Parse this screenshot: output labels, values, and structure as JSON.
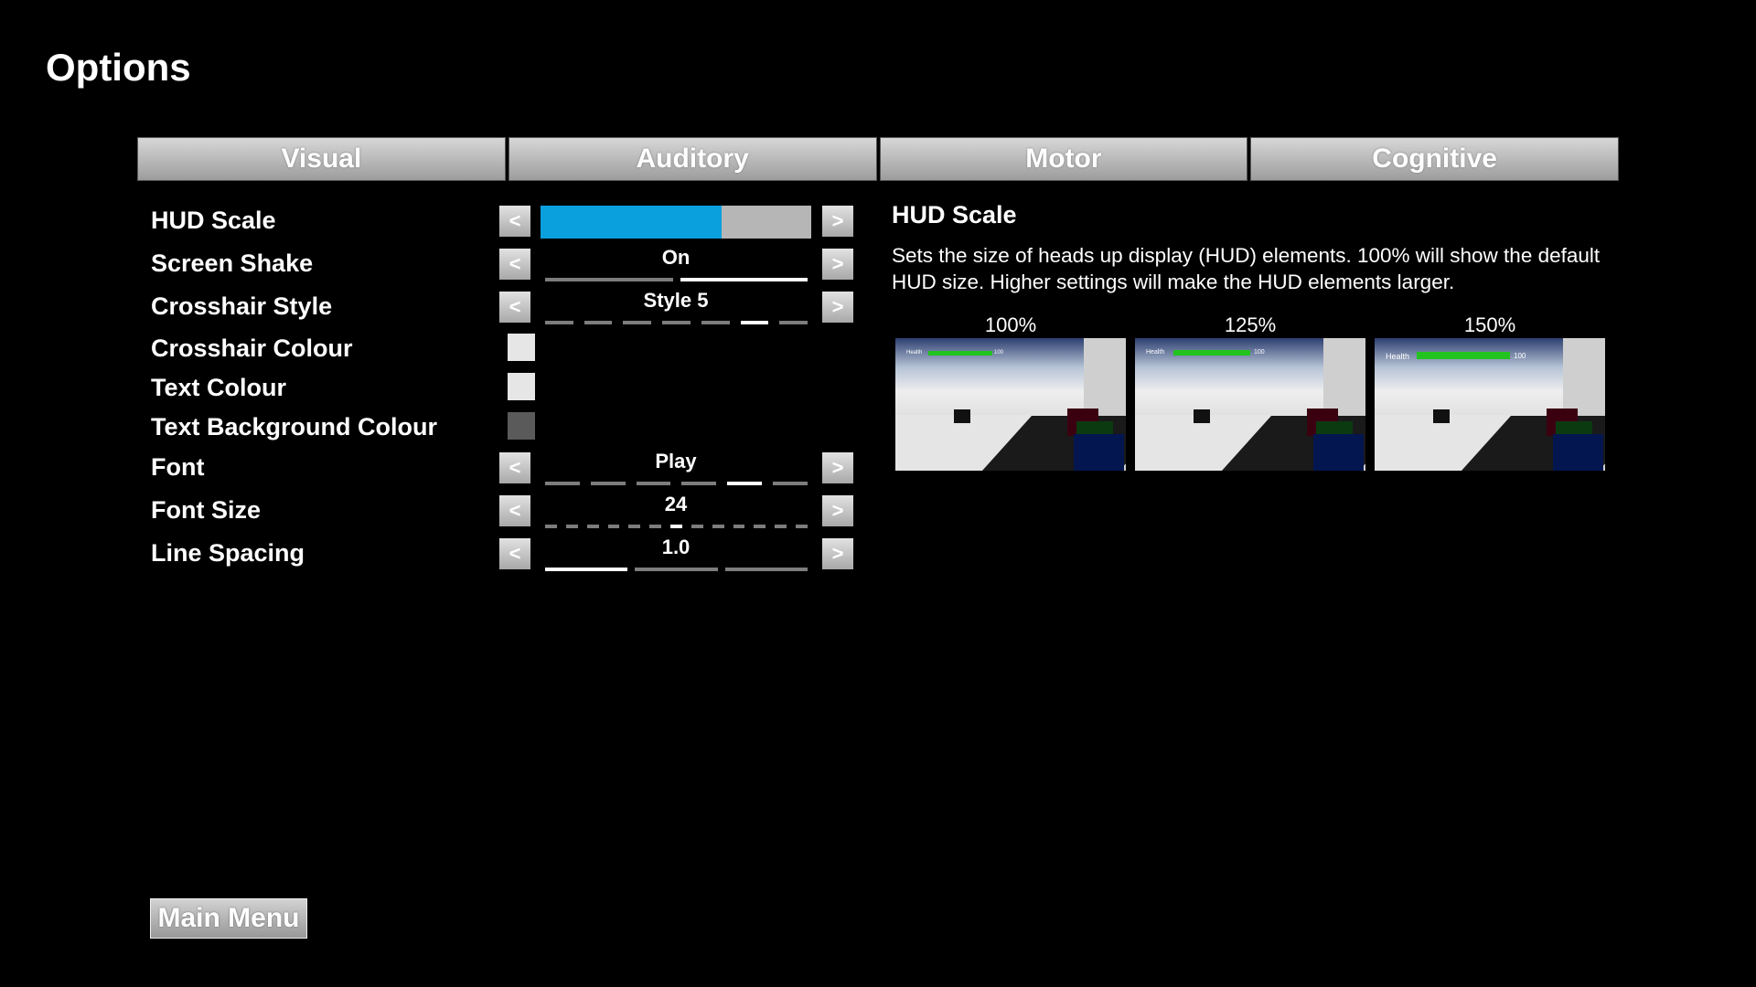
{
  "title": "Options",
  "tabs": [
    {
      "label": "Visual"
    },
    {
      "label": "Auditory"
    },
    {
      "label": "Motor"
    },
    {
      "label": "Cognitive"
    }
  ],
  "settings": {
    "hud_scale": {
      "label": "HUD Scale",
      "fill_percent": 67,
      "fill_color": "#0aa0de"
    },
    "screen_shake": {
      "label": "Screen Shake",
      "value": "On",
      "segments": 2,
      "selected_index": 1
    },
    "crosshair_style": {
      "label": "Crosshair Style",
      "value": "Style 5",
      "segments": 7,
      "selected_index": 5
    },
    "crosshair_colour": {
      "label": "Crosshair Colour",
      "swatch_color": "#e6e6e6"
    },
    "text_colour": {
      "label": "Text Colour",
      "swatch_color": "#e6e6e6"
    },
    "text_background_colour": {
      "label": "Text Background Colour",
      "swatch_color": "#5a5a5a"
    },
    "font": {
      "label": "Font",
      "value": "Play",
      "segments": 6,
      "selected_index": 4
    },
    "font_size": {
      "label": "Font Size",
      "value": "24",
      "segments": 13,
      "selected_index": 6
    },
    "line_spacing": {
      "label": "Line Spacing",
      "value": "1.0",
      "segments": 3,
      "selected_index": 0
    }
  },
  "arrows": {
    "left": "<",
    "right": ">"
  },
  "description": {
    "title": "HUD Scale",
    "text": "Sets the size of heads up display (HUD) elements.  100% will show the default HUD size.  Higher settings will make the HUD elements larger.",
    "previews": [
      {
        "label": "100%",
        "health_label": "Health",
        "health_value": "100"
      },
      {
        "label": "125%",
        "health_label": "Health",
        "health_value": "100"
      },
      {
        "label": "150%",
        "health_label": "Health",
        "health_value": "100"
      }
    ]
  },
  "main_menu_button": "Main Menu"
}
